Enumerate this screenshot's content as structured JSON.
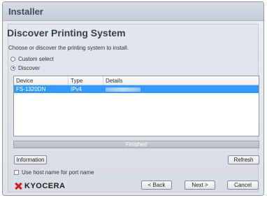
{
  "window": {
    "title": "Installer"
  },
  "page": {
    "heading": "Discover Printing System",
    "instruction": "Choose or discover the printing system to install."
  },
  "options": {
    "custom_select": {
      "label": "Custom select",
      "selected": false
    },
    "discover": {
      "label": "Discover",
      "selected": true
    }
  },
  "device_list": {
    "columns": [
      "Device",
      "Type",
      "Details"
    ],
    "rows": [
      {
        "device": "FS-1320DN",
        "type": "IPv4",
        "details": "",
        "selected": true
      }
    ]
  },
  "status": {
    "text": "Finished"
  },
  "buttons": {
    "information": "Information",
    "refresh": "Refresh",
    "back": "< Back",
    "next": "Next >",
    "cancel": "Cancel"
  },
  "checkbox": {
    "label": "Use host name for port name",
    "checked": false
  },
  "brand": {
    "name": "KYOCERA",
    "color": "#d6191e"
  },
  "colors": {
    "selection": "#3399ff"
  }
}
